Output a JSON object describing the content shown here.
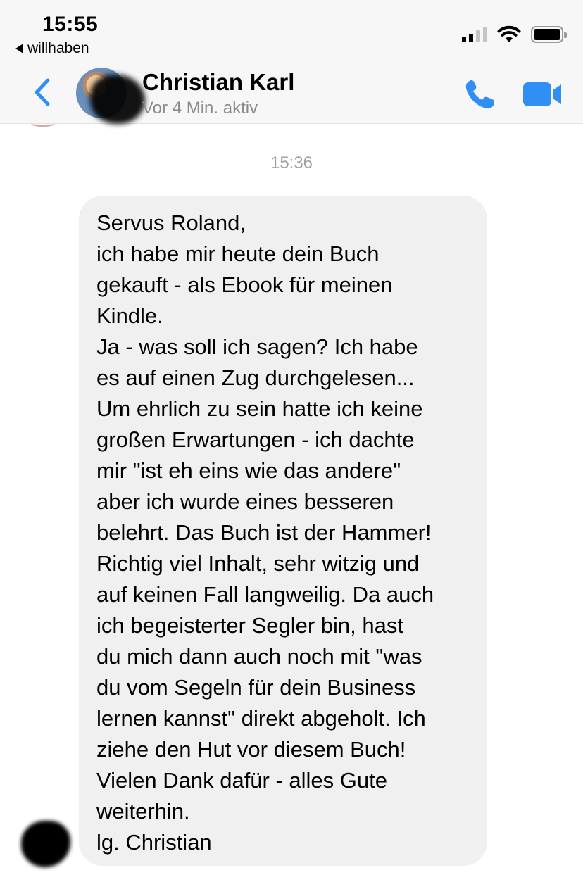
{
  "status_bar": {
    "time": "15:55",
    "back_app_label": "willhaben",
    "signal_bars_active": 2,
    "signal_bars_total": 4,
    "battery_level": 1.0
  },
  "header": {
    "contact_name": "Christian Karl",
    "status": "Vor 4 Min. aktiv",
    "accent_color": "#2f8ff5",
    "icons": [
      "chevron-left-icon",
      "phone-icon",
      "video-camera-icon"
    ]
  },
  "conversation": {
    "timestamp": "15:36",
    "message": {
      "text": "Servus Roland,\nich habe mir heute dein Buch\ngekauft - als Ebook für meinen\nKindle.\nJa - was soll ich sagen? Ich habe\nes auf einen Zug durchgelesen...\nUm ehrlich zu sein hatte ich keine\ngroßen Erwartungen - ich dachte\nmir \"ist eh eins wie das andere\"\naber ich wurde eines besseren\nbelehrt. Das Buch ist der Hammer!\nRichtig viel Inhalt, sehr witzig und\nauf keinen Fall langweilig. Da auch\nich begeisterter Segler bin, hast\ndu mich dann auch noch mit \"was\ndu vom Segeln für dein Business\nlernen kannst\" direkt abgeholt. Ich\nziehe den Hut vor diesem Buch!\nVielen Dank dafür - alles Gute\nweiterhin.\nlg. Christian",
      "bubble_color": "#f0f0f0"
    }
  }
}
